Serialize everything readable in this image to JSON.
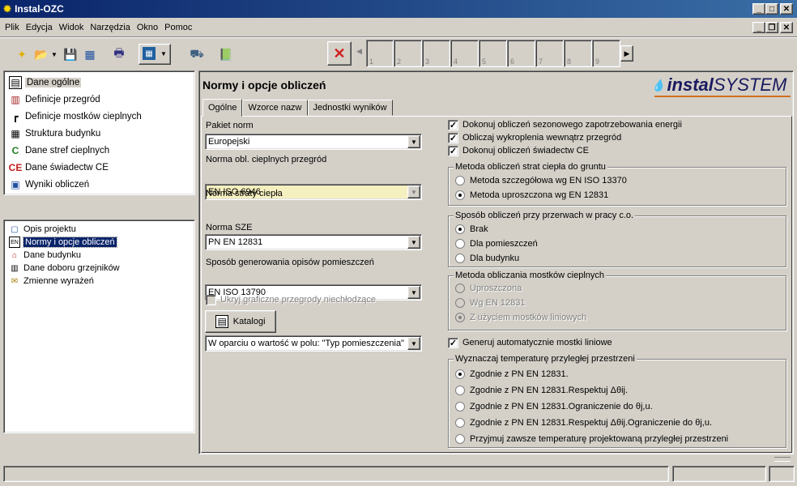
{
  "window": {
    "title": "Instal-OZC"
  },
  "menu": [
    "Plik",
    "Edycja",
    "Widok",
    "Narzędzia",
    "Okno",
    "Pomoc"
  ],
  "toolbar": {
    "pages": [
      "1",
      "2",
      "3",
      "4",
      "5",
      "6",
      "7",
      "8",
      "9"
    ]
  },
  "tree": {
    "items": [
      {
        "label": "Dane ogólne",
        "icon": "general-data-icon"
      },
      {
        "label": "Definicje przegród",
        "icon": "partitions-icon"
      },
      {
        "label": "Definicje mostków cieplnych",
        "icon": "thermal-bridges-icon"
      },
      {
        "label": "Struktura budynku",
        "icon": "building-structure-icon"
      },
      {
        "label": "Dane stref cieplnych",
        "icon": "thermal-zones-icon"
      },
      {
        "label": "Dane świadectw CE",
        "icon": "ce-certificate-icon"
      },
      {
        "label": "Wyniki obliczeń",
        "icon": "results-icon"
      }
    ]
  },
  "list": {
    "items": [
      {
        "label": "Opis projektu"
      },
      {
        "label": "Normy i opcje obliczeń"
      },
      {
        "label": "Dane budynku"
      },
      {
        "label": "Dane doboru grzejników"
      },
      {
        "label": "Zmienne wyrażeń"
      }
    ]
  },
  "panel": {
    "title": "Normy i opcje obliczeń",
    "logo_prefix": "instal",
    "logo_suffix": "SYSTEM"
  },
  "tabs": [
    "Ogólne",
    "Wzorce nazw",
    "Jednostki wyników"
  ],
  "left": {
    "pakiet_label": "Pakiet norm",
    "pakiet_value": "Europejski",
    "przegrod_label": "Norma obl. cieplnych przegród",
    "przegrod_value": "EN ISO 6946",
    "straty_label": "Norma straty ciepła",
    "straty_value": "PN EN 12831",
    "sze_label": "Norma SZE",
    "sze_value": "EN ISO 13790",
    "opisy_label": "Sposób generowania opisów pomieszczeń",
    "opisy_value": "W oparciu o wartość w polu: \"Typ pomieszczenia\"",
    "ukryj_label": "Ukryj graficzne przegrody niechłodzące",
    "katalogi_label": "Katalogi"
  },
  "checks": [
    {
      "label": "Dokonuj obliczeń sezonowego zapotrzebowania energii",
      "checked": true
    },
    {
      "label": "Obliczaj wykroplenia wewnątrz przegród",
      "checked": true
    },
    {
      "label": "Dokonuj obliczeń świadectw CE",
      "checked": true
    }
  ],
  "g1": {
    "title": "Metoda obliczeń strat ciepła do gruntu",
    "options": [
      "Metoda szczegółowa wg EN ISO 13370",
      "Metoda uproszczona wg EN 12831"
    ]
  },
  "g2": {
    "title": "Sposób obliczeń przy przerwach w pracy c.o.",
    "options": [
      "Brak",
      "Dla pomieszczeń",
      "Dla budynku"
    ]
  },
  "g3": {
    "title": "Metoda obliczania mostków cieplnych",
    "options": [
      "Uproszczona",
      "Wg EN 12831",
      "Z użyciem mostków liniowych"
    ]
  },
  "gen_label": "Generuj automatycznie mostki liniowe",
  "g4": {
    "title": "Wyznaczaj temperaturę przyległej przestrzeni",
    "options": [
      "Zgodnie z PN EN 12831.",
      "Zgodnie z PN EN 12831.Respektuj Δθij.",
      "Zgodnie z PN EN 12831.Ograniczenie do θj,u.",
      "Zgodnie z PN EN 12831.Respektuj Δθij.Ograniczenie do θj,u.",
      "Przyjmuj zawsze temperaturę projektowaną przyległej przestrzeni"
    ]
  }
}
